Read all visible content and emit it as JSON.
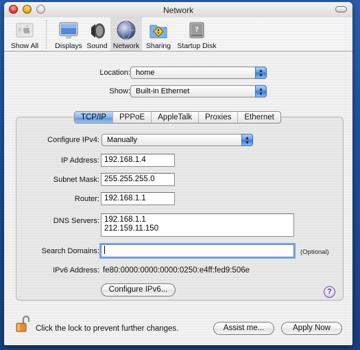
{
  "window": {
    "title": "Network"
  },
  "toolbar": {
    "items": [
      {
        "label": "Show All",
        "icon": "apple-show-all-icon",
        "selected": false
      },
      {
        "label": "Displays",
        "icon": "display-icon",
        "selected": false
      },
      {
        "label": "Sound",
        "icon": "speaker-icon",
        "selected": false
      },
      {
        "label": "Network",
        "icon": "globe-icon",
        "selected": true
      },
      {
        "label": "Sharing",
        "icon": "sharing-folder-icon",
        "selected": false
      },
      {
        "label": "Startup Disk",
        "icon": "hard-disk-icon",
        "selected": false
      }
    ]
  },
  "location": {
    "label": "Location:",
    "value": "home"
  },
  "show": {
    "label": "Show:",
    "value": "Built-in Ethernet"
  },
  "tabs": [
    {
      "label": "TCP/IP",
      "active": true
    },
    {
      "label": "PPPoE",
      "active": false
    },
    {
      "label": "AppleTalk",
      "active": false
    },
    {
      "label": "Proxies",
      "active": false
    },
    {
      "label": "Ethernet",
      "active": false
    }
  ],
  "tcpip": {
    "configure_ipv4": {
      "label": "Configure IPv4:",
      "value": "Manually"
    },
    "ip_address": {
      "label": "IP Address:",
      "value": "192.168.1.4"
    },
    "subnet_mask": {
      "label": "Subnet Mask:",
      "value": "255.255.255.0"
    },
    "router": {
      "label": "Router:",
      "value": "192.168.1.1"
    },
    "dns_servers": {
      "label": "DNS Servers:",
      "values": [
        "192.168.1.1",
        "212.159.11.150"
      ]
    },
    "search_domains": {
      "label": "Search Domains:",
      "value": "",
      "hint": "(Optional)"
    },
    "ipv6_address": {
      "label": "IPv6 Address:",
      "value": "fe80:0000:0000:0000:0250:e4ff:fed9:506e"
    },
    "configure_ipv6_button": "Configure IPv6...",
    "help_glyph": "?"
  },
  "footer": {
    "lock_text": "Click the lock to prevent further changes.",
    "assist_button": "Assist me...",
    "apply_button": "Apply Now"
  },
  "colors": {
    "desktop": "#1d4f97",
    "selection_blue": "#5c98e3",
    "help_purple": "#6b4f9c"
  }
}
